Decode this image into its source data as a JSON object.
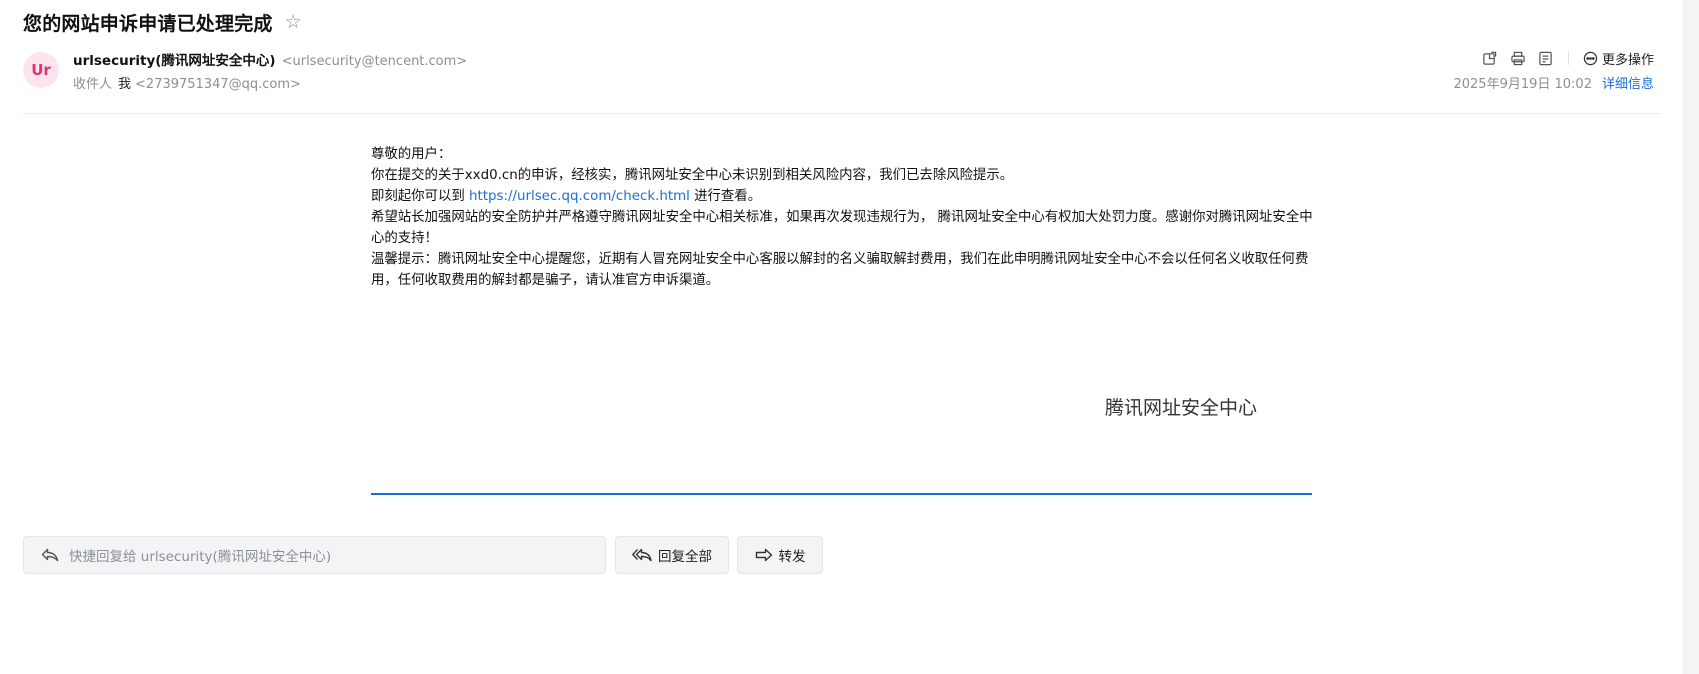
{
  "subject": "您的网站申诉申请已处理完成",
  "sender": {
    "avatar_text": "Ur",
    "name": "urlsecurity(腾讯网址安全中心)",
    "email": "<urlsecurity@tencent.com>"
  },
  "recipient": {
    "label": "收件人",
    "name": "我",
    "email": "<2739751347@qq.com>"
  },
  "toolbar": {
    "more_label": "更多操作"
  },
  "meta": {
    "date": "2025年9月19日 10:02",
    "detail_label": "详细信息"
  },
  "body": {
    "greeting": "尊敬的用户：",
    "line1": "你在提交的关于xxd0.cn的申诉，经核实，腾讯网址安全中心未识别到相关风险内容，我们已去除风险提示。",
    "line2_prefix": "即刻起你可以到 ",
    "line2_link": "https://urlsec.qq.com/check.html",
    "line2_suffix": " 进行查看。",
    "line3": "希望站长加强网站的安全防护并严格遵守腾讯网址安全中心相关标准，如果再次发现违规行为， 腾讯网址安全中心有权加大处罚力度。感谢你对腾讯网址安全中心的支持！",
    "line4": "温馨提示：腾讯网址安全中心提醒您，近期有人冒充网址安全中心客服以解封的名义骗取解封费用，我们在此申明腾讯网址安全中心不会以任何名义收取任何费用，任何收取费用的解封都是骗子，请认准官方申诉渠道。",
    "signature": "腾讯网址安全中心"
  },
  "actions": {
    "quick_reply_placeholder": "快捷回复给 urlsecurity(腾讯网址安全中心)",
    "reply_all_label": "回复全部",
    "forward_label": "转发"
  }
}
